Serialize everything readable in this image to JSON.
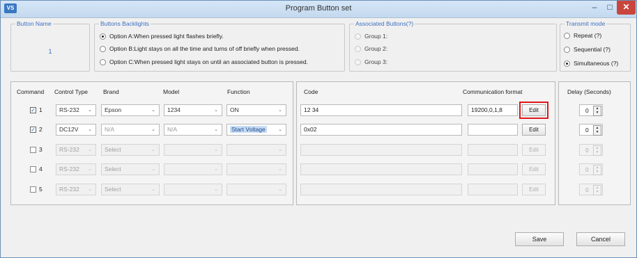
{
  "window": {
    "title": "Program Button set",
    "logo_text": "VS",
    "minimize": "–",
    "maximize": "□",
    "close": "✕"
  },
  "button_name": {
    "legend": "Button Name",
    "value": "1"
  },
  "backlights": {
    "legend": "Buttons Backlights",
    "options": [
      {
        "label": "Option A:When pressed light flashes briefly.",
        "selected": true
      },
      {
        "label": "Option B:Light stays on all the time and turns of off briefly when pressed.",
        "selected": false
      },
      {
        "label": "Option C:When pressed light stays on until an associated button is pressed.",
        "selected": false
      }
    ]
  },
  "associated": {
    "legend": "Associated Buttons(?)",
    "groups": [
      "Group 1:",
      "Group 2:",
      "Group 3:"
    ]
  },
  "transmit": {
    "legend": "Transmit mode",
    "options": [
      {
        "label": "Repeat (?)",
        "selected": false
      },
      {
        "label": "Sequential (?)",
        "selected": false
      },
      {
        "label": "Simultaneous (?)",
        "selected": true
      }
    ]
  },
  "headers": {
    "command": "Command",
    "control_type": "Control Type",
    "brand": "Brand",
    "model": "Model",
    "function": "Function",
    "code": "Code",
    "comm_format": "Communication format",
    "delay": "Delay (Seconds)"
  },
  "rows": [
    {
      "num": "1",
      "checked": true,
      "checkmark": "✓",
      "control": "RS-232",
      "brand": "Epson",
      "model": "1234",
      "function": "ON",
      "code": "12 34",
      "format": "19200,0,1,8",
      "edit": "Edit",
      "delay": "0"
    },
    {
      "num": "2",
      "checked": true,
      "checkmark": "✓",
      "control": "DC12V",
      "brand": "N/A",
      "model": "N/A",
      "function": "Start Voltage",
      "code": "0x02",
      "format": "",
      "edit": "Edit",
      "delay": "0"
    },
    {
      "num": "3",
      "checked": false,
      "checkmark": "",
      "control": "RS-232",
      "brand": "Select",
      "model": "",
      "function": "",
      "code": "",
      "format": "",
      "edit": "Edit",
      "delay": "0"
    },
    {
      "num": "4",
      "checked": false,
      "checkmark": "",
      "control": "RS-232",
      "brand": "Select",
      "model": "",
      "function": "",
      "code": "",
      "format": "",
      "edit": "Edit",
      "delay": "0"
    },
    {
      "num": "5",
      "checked": false,
      "checkmark": "",
      "control": "RS-232",
      "brand": "Select",
      "model": "",
      "function": "",
      "code": "",
      "format": "",
      "edit": "Edit",
      "delay": "0"
    }
  ],
  "dropdown_arrow": "⌄",
  "spin_up": "▲",
  "spin_down": "▼",
  "actions": {
    "save": "Save",
    "cancel": "Cancel"
  },
  "colors": {
    "highlight_outline": "#e0161b",
    "legend_blue": "#3c6fc0",
    "close_red": "#c9463d"
  }
}
